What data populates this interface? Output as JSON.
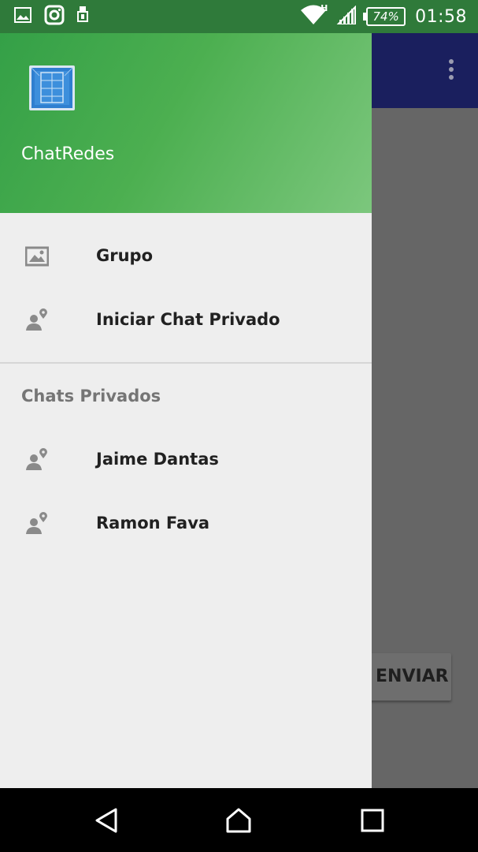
{
  "status_bar": {
    "time": "01:58",
    "battery": "74%",
    "network_type": "H",
    "left_icons": [
      "image-icon",
      "instagram-icon",
      "usb-icon"
    ]
  },
  "app": {
    "send_button_label": "ENVIAR"
  },
  "drawer": {
    "header": {
      "app_name": "ChatRedes"
    },
    "items": [
      {
        "label": "Grupo",
        "icon": "group-image-icon"
      },
      {
        "label": "Iniciar Chat Privado",
        "icon": "person-pin-icon"
      }
    ],
    "section_title": "Chats Privados",
    "private_chats": [
      {
        "label": "Jaime Dantas",
        "icon": "person-pin-icon"
      },
      {
        "label": "Ramon Fava",
        "icon": "person-pin-icon"
      }
    ]
  },
  "colors": {
    "status_bar": "#2f7a3a",
    "drawer_header": "#4caf50",
    "toolbar": "#1a1f5e",
    "scrim": "#666666"
  }
}
